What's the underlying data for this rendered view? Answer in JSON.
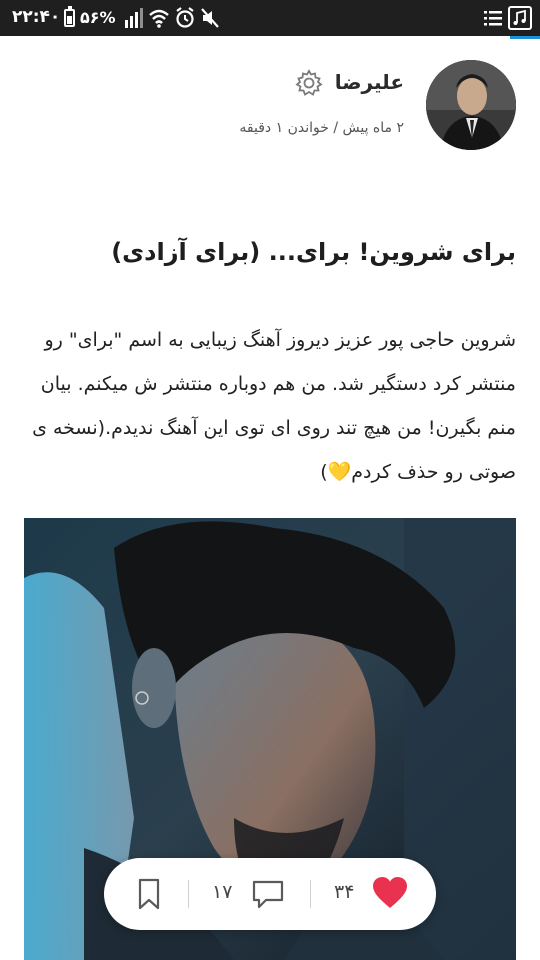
{
  "status_bar": {
    "time": "۲۲:۴۰",
    "battery": "۵۶%"
  },
  "author": {
    "name": "علیرضا",
    "meta": "۲ ماه پیش / خواندن ۱ دقیقه"
  },
  "post": {
    "title": "برای شروین! برای... (برای آزادی)",
    "body": "شروین حاجی پور عزیز دیروز آهنگ زیبایی به اسم \"برای\" رو منتشر کرد دستگیر شد. من هم دوباره منتشر ش میکنم. بیان منم بگیرن! من هیچ تند روی ای توی این آهنگ ندیدم.(نسخه ی صوتی رو حذف کردم💛)"
  },
  "actions": {
    "likes": "۳۴",
    "comments": "۱۷"
  },
  "icons": {
    "like": "heart-icon",
    "comment": "comment-icon",
    "bookmark": "bookmark-icon",
    "settings": "gear-icon"
  },
  "colors": {
    "like": "#e8324f",
    "accent": "#1c8fd6",
    "status_bar": "#1f1f1f"
  }
}
